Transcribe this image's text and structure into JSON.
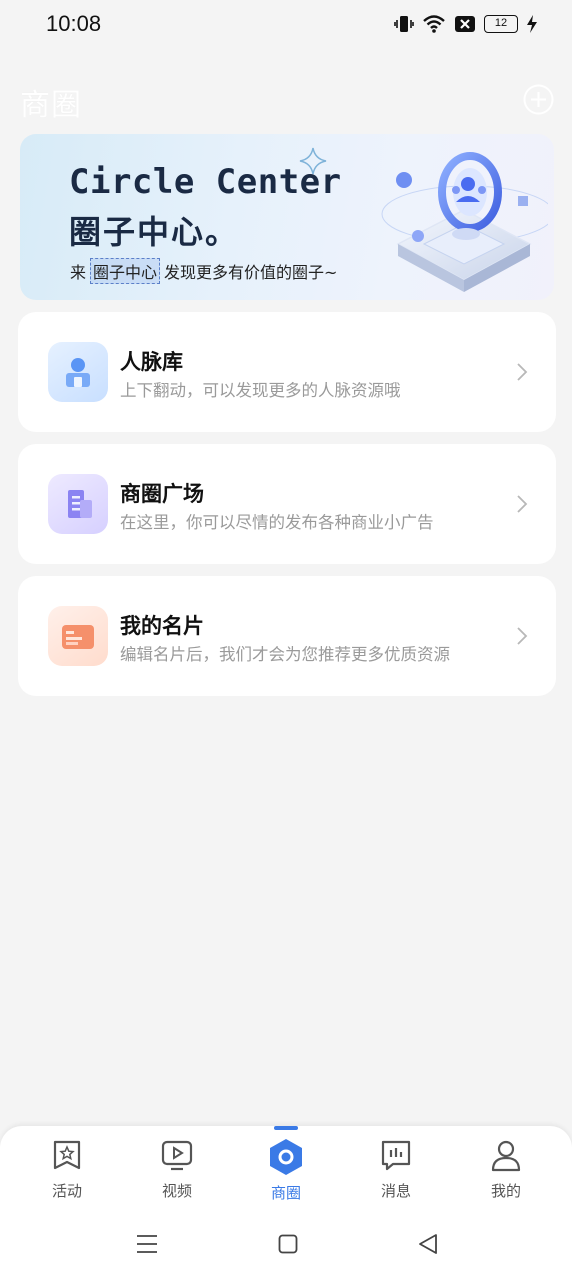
{
  "status": {
    "time": "10:08",
    "battery": "12"
  },
  "header": {
    "title": "商圈"
  },
  "banner": {
    "title_en": "Circle Center",
    "title_cn": "圈子中心。",
    "subtitle_pre": "来",
    "subtitle_highlight": "圈子中心",
    "subtitle_post": "发现更多有价值的圈子~"
  },
  "cards": [
    {
      "title": "人脉库",
      "desc": "上下翻动，可以发现更多的人脉资源哦",
      "icon": "contacts-icon"
    },
    {
      "title": "商圈广场",
      "desc": "在这里，你可以尽情的发布各种商业小广告",
      "icon": "building-icon"
    },
    {
      "title": "我的名片",
      "desc": "编辑名片后，我们才会为您推荐更多优质资源",
      "icon": "card-icon"
    }
  ],
  "nav": {
    "items": [
      {
        "label": "活动",
        "icon": "star-bookmark-icon"
      },
      {
        "label": "视频",
        "icon": "video-icon"
      },
      {
        "label": "商圈",
        "icon": "circle-hex-icon",
        "active": true
      },
      {
        "label": "消息",
        "icon": "message-icon"
      },
      {
        "label": "我的",
        "icon": "person-icon"
      }
    ],
    "active_color": "#3a7ae6"
  }
}
